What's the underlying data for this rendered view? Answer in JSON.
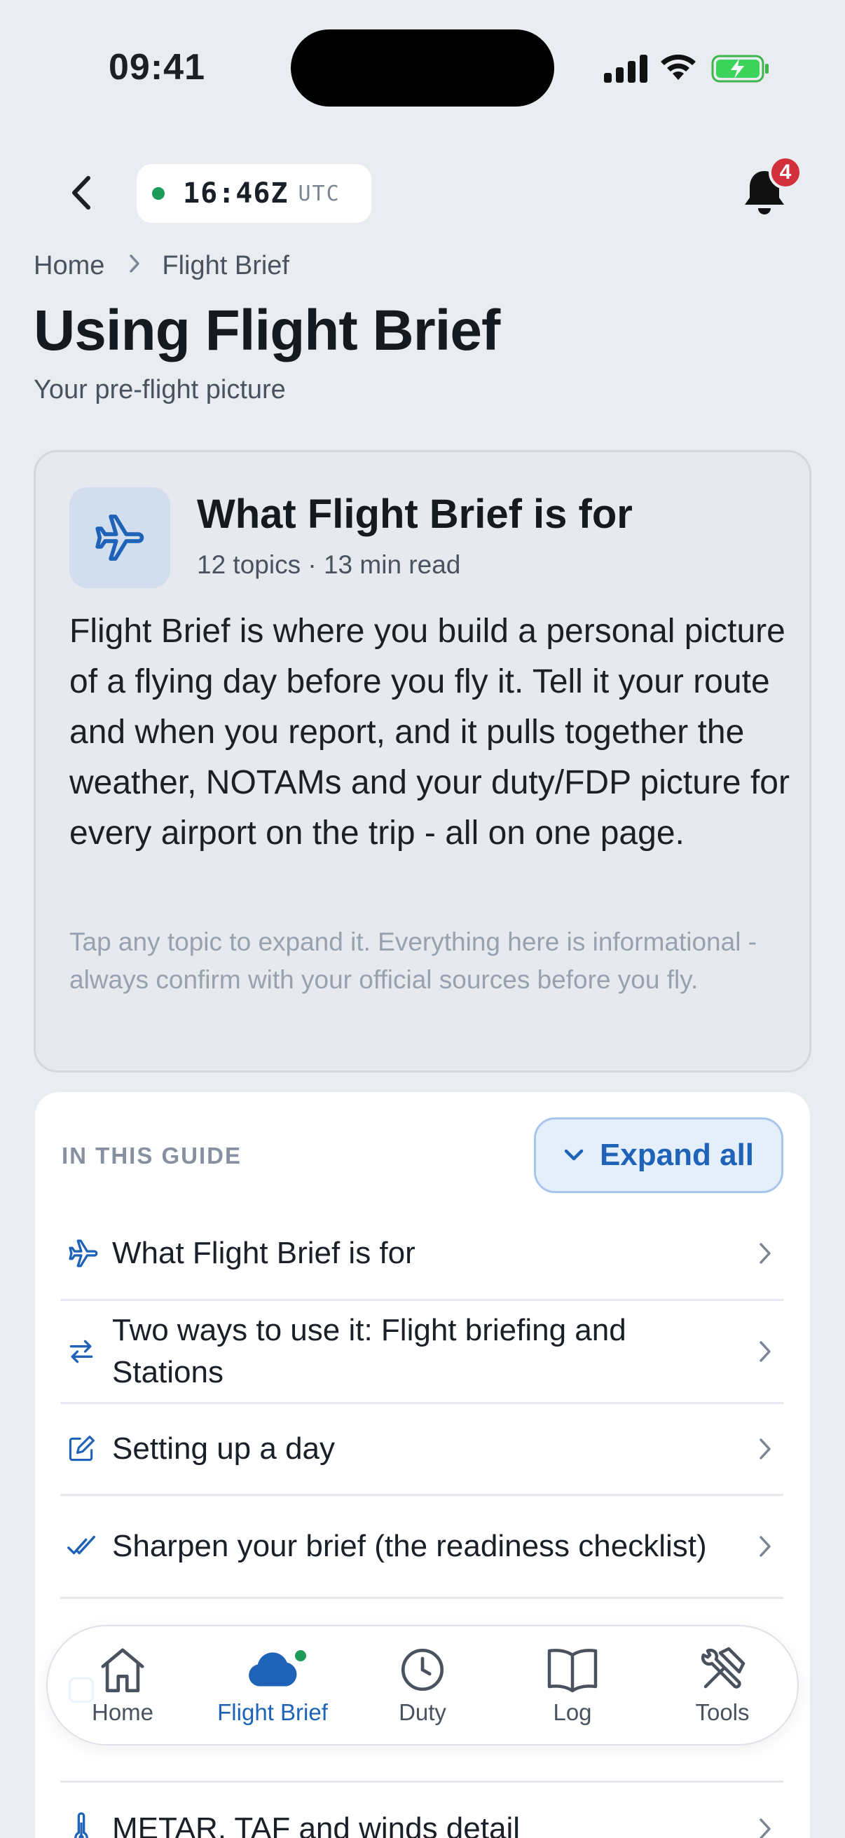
{
  "status_bar": {
    "time": "09:41"
  },
  "header": {
    "utc_time": "16:46Z",
    "utc_label": "UTC",
    "notification_count": "4"
  },
  "breadcrumb": {
    "home": "Home",
    "current": "Flight Brief"
  },
  "page": {
    "title": "Using Flight Brief",
    "subtitle": "Your pre-flight picture"
  },
  "intro": {
    "title": "What Flight Brief is for",
    "meta": "12 topics · 13 min read",
    "body": "Flight Brief is where you build a personal picture of a flying day before you fly it. Tell it your route and when you report, and it pulls together the weather, NOTAMs and your duty/FDP picture for every airport on the trip - all on one page.",
    "note": "Tap any topic to expand it. Everything here is informational - always confirm with your official sources before you fly."
  },
  "guide": {
    "label": "IN THIS GUIDE",
    "expand_label": "Expand all",
    "items": [
      {
        "icon": "airplane-icon",
        "label": "What Flight Brief is for"
      },
      {
        "icon": "swap-arrows-icon",
        "label": "Two ways to use it: Flight briefing and Stations"
      },
      {
        "icon": "edit-icon",
        "label": "Setting up a day"
      },
      {
        "icon": "double-check-icon",
        "label": "Sharpen your brief (the readiness checklist)"
      },
      {
        "icon": "topic-icon",
        "label": ""
      },
      {
        "icon": "thermometer-icon",
        "label": "METAR, TAF and winds detail"
      }
    ]
  },
  "nav": {
    "items": [
      {
        "icon": "home-icon",
        "label": "Home"
      },
      {
        "icon": "cloud-icon",
        "label": "Flight Brief"
      },
      {
        "icon": "clock-icon",
        "label": "Duty"
      },
      {
        "icon": "book-icon",
        "label": "Log"
      },
      {
        "icon": "tools-icon",
        "label": "Tools"
      }
    ],
    "active": "Flight Brief"
  },
  "colors": {
    "accent": "#1e63b8",
    "online": "#1e9b5b",
    "badge": "#d2303b",
    "background": "#e9edf2"
  }
}
